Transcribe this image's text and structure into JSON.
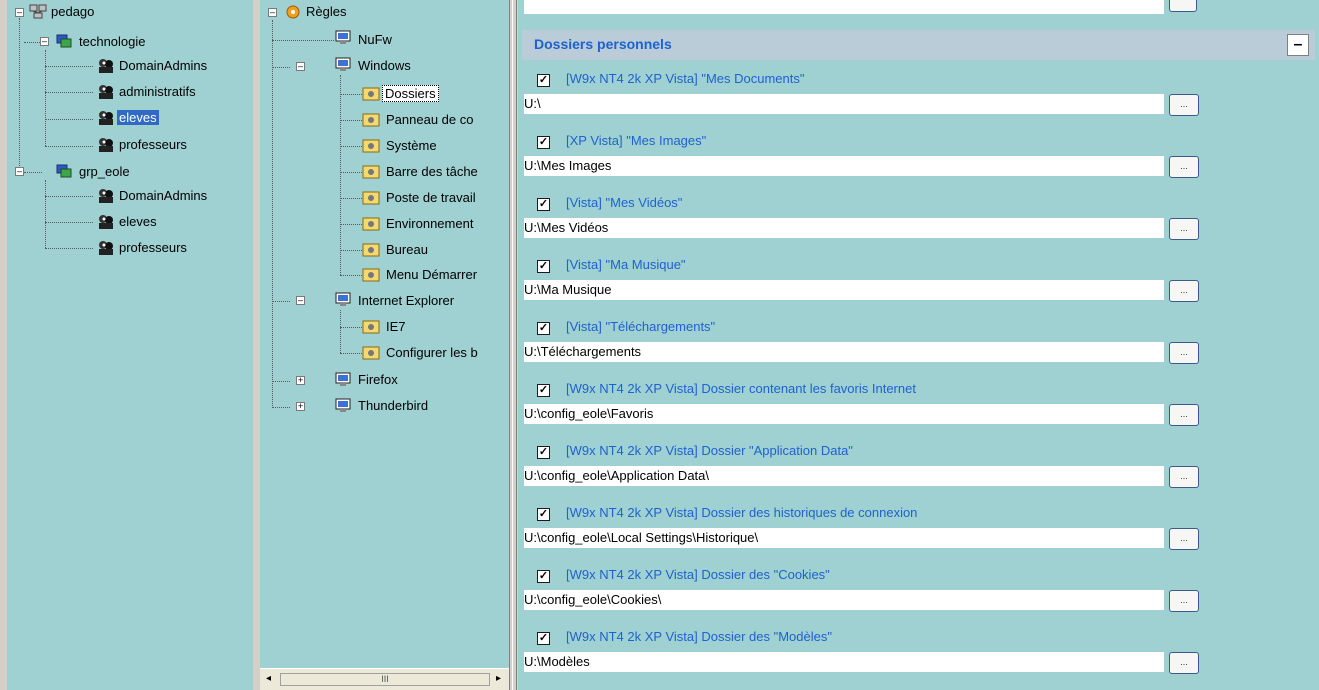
{
  "left_tree": {
    "root": "pedago",
    "groups": [
      {
        "label": "technologie",
        "items": [
          "DomainAdmins",
          "administratifs",
          "eleves",
          "professeurs"
        ]
      },
      {
        "label": "grp_eole",
        "items": [
          "DomainAdmins",
          "eleves",
          "professeurs"
        ]
      }
    ]
  },
  "mid_tree": {
    "root": "Règles",
    "nufw": "NuFw",
    "windows": "Windows",
    "windows_items": [
      "Dossiers",
      "Panneau de co",
      "Système",
      "Barre des tâche",
      "Poste de travail",
      "Environnement",
      "Bureau",
      "Menu Démarrer"
    ],
    "ie": "Internet Explorer",
    "ie_items": [
      "IE7",
      "Configurer les b"
    ],
    "firefox": "Firefox",
    "thunderbird": "Thunderbird"
  },
  "section": {
    "title": "Dossiers personnels",
    "collapse_label": "–"
  },
  "browse_label": "...",
  "entries": [
    {
      "title": "[W9x NT4 2k XP Vista] \"Mes Documents\"",
      "value": "U:\\"
    },
    {
      "title": "[XP Vista] \"Mes Images\"",
      "value": "U:\\Mes Images"
    },
    {
      "title": "[Vista] \"Mes Vidéos\"",
      "value": "U:\\Mes Vidéos"
    },
    {
      "title": "[Vista] \"Ma Musique\"",
      "value": "U:\\Ma Musique"
    },
    {
      "title": "[Vista] \"Téléchargements\"",
      "value": "U:\\Téléchargements"
    },
    {
      "title": "[W9x NT4 2k XP Vista] Dossier contenant les favoris Internet",
      "value": "U:\\config_eole\\Favoris"
    },
    {
      "title": "[W9x NT4 2k XP Vista] Dossier \"Application Data\"",
      "value": "U:\\config_eole\\Application Data\\"
    },
    {
      "title": "[W9x NT4 2k XP Vista] Dossier des historiques de connexion",
      "value": "U:\\config_eole\\Local Settings\\Historique\\"
    },
    {
      "title": "[W9x NT4 2k XP Vista] Dossier des \"Cookies\"",
      "value": "U:\\config_eole\\Cookies\\"
    },
    {
      "title": "[W9x NT4 2k XP Vista] Dossier des \"Modèles\"",
      "value": "U:\\Modèles"
    }
  ],
  "scrollbar_thumb": "III"
}
